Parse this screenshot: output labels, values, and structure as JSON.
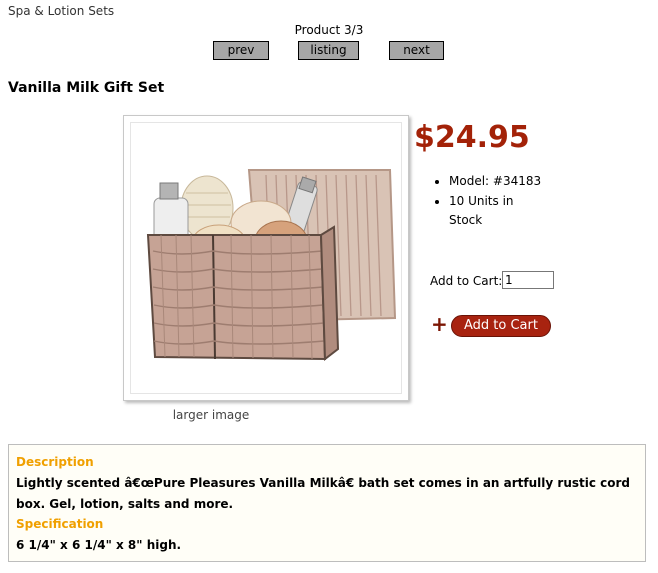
{
  "breadcrumb": "Spa & Lotion Sets",
  "nav": {
    "counter": "Product 3/3",
    "prev_label": "prev",
    "listing_label": "listing",
    "next_label": "next"
  },
  "product": {
    "name": "Vanilla Milk Gift Set",
    "price": "$24.95",
    "details": [
      "Model: #34183",
      "10 Units in Stock"
    ],
    "larger_image_label": "larger image"
  },
  "cart": {
    "label": "Add to Cart:",
    "quantity": "1",
    "button_label": "Add to Cart",
    "plus_symbol": "+"
  },
  "description": {
    "heading": "Description",
    "text": "Lightly scented â€œPure Pleasures Vanilla Milkâ€ bath set comes in an artfully rustic cord box. Gel, lotion, salts and more.",
    "spec_heading": "Specification",
    "spec_text": "6 1/4\" x 6 1/4\" x 8\" high."
  },
  "colors": {
    "price": "#a32208",
    "add_button": "#a82310",
    "section_heading": "#f0a000",
    "nav_button": "#a6a6a6"
  }
}
